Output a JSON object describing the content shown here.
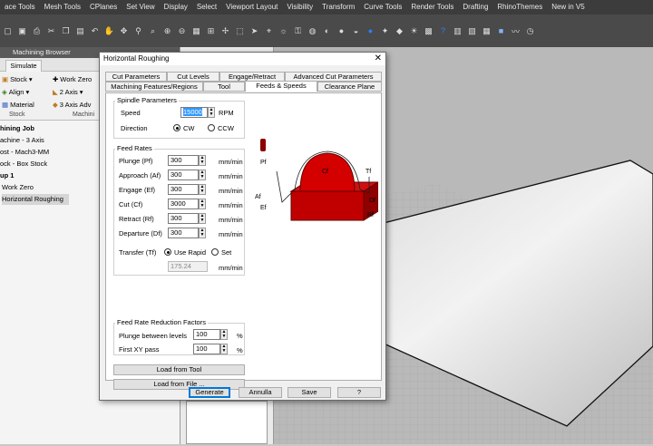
{
  "menubar": [
    "ace Tools",
    "Mesh Tools",
    "CPlanes",
    "Set View",
    "Display",
    "Select",
    "Viewport Layout",
    "Visibility",
    "Transform",
    "Curve Tools",
    "Render Tools",
    "Drafting",
    "RhinoThemes",
    "New in V5"
  ],
  "browser": {
    "title": "Machining Browser",
    "tab": "Simulate",
    "ribbon": {
      "stock": "Stock",
      "align": "Align",
      "material": "Material",
      "stock_group": "Stock",
      "work_zero": "Work Zero",
      "two_axis": "2 Axis",
      "three_axis_adv": "3 Axis Adv",
      "machining_group": "Machini"
    },
    "tree": [
      "hining Job",
      "achine - 3 Axis",
      "ost - Mach3-MM",
      "ock - Box Stock",
      "up 1",
      "Work Zero",
      "Horizontal Roughing"
    ]
  },
  "dialog": {
    "title": "Horizontal Roughing",
    "close": "✕",
    "tabs_row1": [
      "Cut Parameters",
      "Cut Levels",
      "Engage/Retract",
      "Advanced Cut Parameters"
    ],
    "tabs_row2": [
      "Machining Features/Regions",
      "Tool",
      "Feeds & Speeds",
      "Clearance Plane"
    ],
    "spindle": {
      "title": "Spindle Parameters",
      "speed_label": "Speed",
      "speed_value": "15000",
      "speed_unit": "RPM",
      "direction_label": "Direction",
      "cw": "CW",
      "ccw": "CCW"
    },
    "feed": {
      "title": "Feed Rates",
      "rows": [
        {
          "label": "Plunge (Pf)",
          "value": "300",
          "unit": "mm/min"
        },
        {
          "label": "Approach (Af)",
          "value": "300",
          "unit": "mm/min"
        },
        {
          "label": "Engage (Ef)",
          "value": "300",
          "unit": "mm/min"
        },
        {
          "label": "Cut (Cf)",
          "value": "3000",
          "unit": "mm/min"
        },
        {
          "label": "Retract (Rf)",
          "value": "300",
          "unit": "mm/min"
        },
        {
          "label": "Departure  (Df)",
          "value": "300",
          "unit": "mm/min"
        }
      ],
      "transfer_label": "Transfer (Tf)",
      "use_rapid": "Use Rapid",
      "set": "Set",
      "transfer_value": "175.24",
      "transfer_unit": "mm/min"
    },
    "reduction": {
      "title": "Feed Rate Reduction Factors",
      "plunge_label": "Plunge between levels",
      "plunge_value": "100",
      "xy_label": "First XY pass",
      "xy_value": "100",
      "unit": "%"
    },
    "diagram_labels": {
      "pf": "Pf",
      "cf": "Cf",
      "tf": "Tf",
      "af": "Af",
      "df": "Df",
      "ef": "Ef",
      "rf": "Rf"
    },
    "load_tool": "Load from Tool",
    "load_file": "Load from File ...",
    "buttons": {
      "generate": "Generate",
      "cancel": "Annulla",
      "save": "Save",
      "help": "?"
    }
  }
}
